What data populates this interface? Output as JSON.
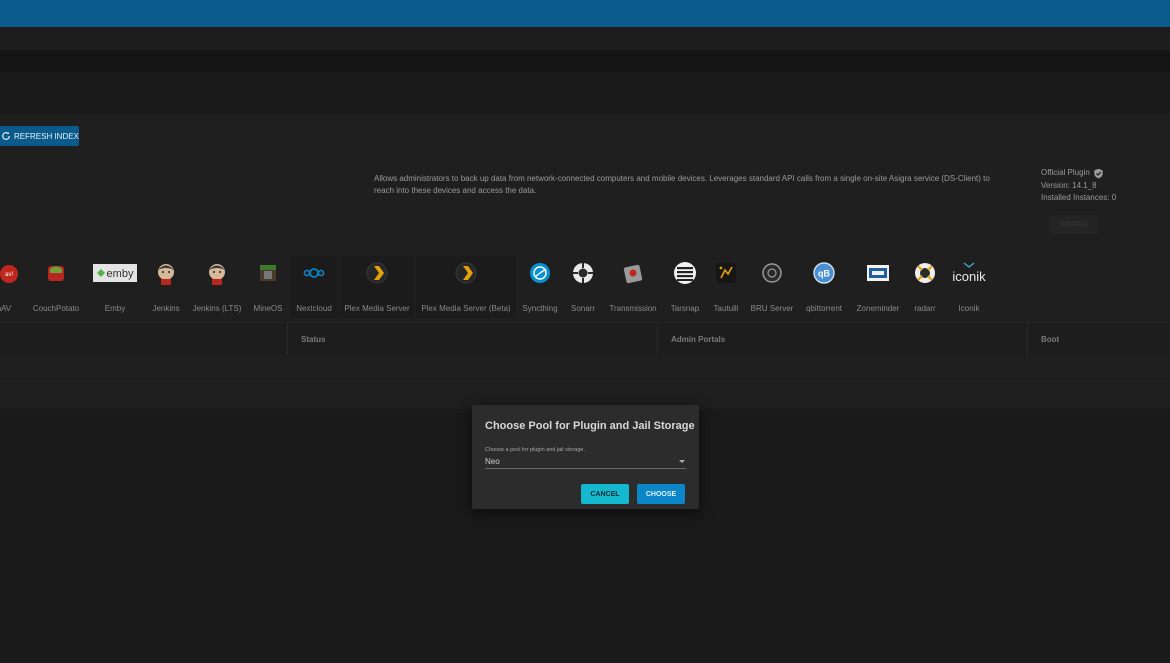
{
  "toolbar": {
    "refresh_label": "REFRESH INDEX"
  },
  "plugin_detail": {
    "description": "Allows administrators to back up data from network-connected computers and mobile devices. Leverages standard API calls from a single on-site Asigra service (DS-Client) to reach into these devices and access the data.",
    "official_label": "Official Plugin",
    "version_label": "Version: 14.1_8",
    "installed_label": "Installed Instances: 0",
    "install_label": "INSTALL"
  },
  "plugins": [
    {
      "label": "amAV",
      "icon": "clamav-icon"
    },
    {
      "label": "CouchPotato",
      "icon": "couchpotato-icon"
    },
    {
      "label": "Emby",
      "icon": "emby-icon",
      "logo_text": "emby"
    },
    {
      "label": "Jenkins",
      "icon": "jenkins-icon"
    },
    {
      "label": "Jenkins (LTS)",
      "icon": "jenkins-lts-icon"
    },
    {
      "label": "MineOS",
      "icon": "mineos-icon"
    },
    {
      "label": "Nextcloud",
      "icon": "nextcloud-icon"
    },
    {
      "label": "Plex Media Server",
      "icon": "plex-icon"
    },
    {
      "label": "Plex Media Server (Beta)",
      "icon": "plex-beta-icon"
    },
    {
      "label": "Syncthing",
      "icon": "syncthing-icon"
    },
    {
      "label": "Sonarr",
      "icon": "sonarr-icon"
    },
    {
      "label": "Transmission",
      "icon": "transmission-icon"
    },
    {
      "label": "Tarsnap",
      "icon": "tarsnap-icon"
    },
    {
      "label": "Tautulli",
      "icon": "tautulli-icon"
    },
    {
      "label": "BRU Server",
      "icon": "bru-server-icon"
    },
    {
      "label": "qbittorrent",
      "icon": "qbittorrent-icon",
      "logo_text": "qB"
    },
    {
      "label": "Zoneminder",
      "icon": "zoneminder-icon"
    },
    {
      "label": "radarr",
      "icon": "radarr-icon"
    },
    {
      "label": "Iconik",
      "icon": "iconik-icon",
      "logo_text": "iconik"
    }
  ],
  "table": {
    "columns": [
      "Status",
      "Admin Portals",
      "Boot"
    ]
  },
  "dialog": {
    "title": "Choose Pool for Plugin and Jail Storage",
    "field_label": "Choose a pool for plugin and jail storage.",
    "selected_pool": "Neo",
    "cancel_label": "CANCEL",
    "choose_label": "CHOOSE"
  },
  "colors": {
    "accent": "#0b5a8c",
    "cancel": "#14b8cf",
    "choose": "#0b86c8",
    "background": "#1a1a1a"
  }
}
